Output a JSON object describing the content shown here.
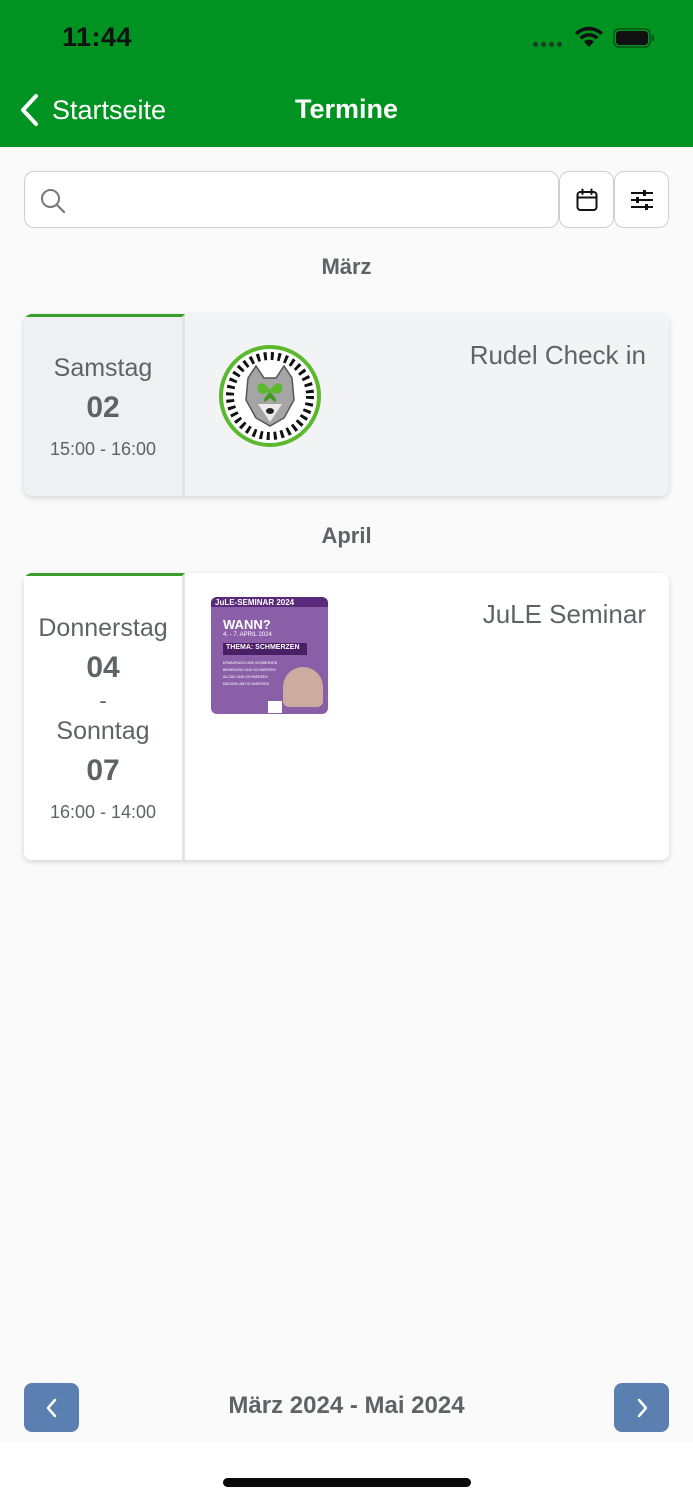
{
  "status": {
    "time": "11:44"
  },
  "nav": {
    "back_label": "Startseite",
    "title": "Termine"
  },
  "search": {
    "value": ""
  },
  "sections": [
    {
      "month": "März",
      "events": [
        {
          "day": "Samstag",
          "date": "02",
          "time": "15:00 - 16:00",
          "title": "Rudel Check in"
        }
      ]
    },
    {
      "month": "April",
      "events": [
        {
          "day_start": "Donnerstag",
          "date_start": "04",
          "dash": "-",
          "day_end": "Sonntag",
          "date_end": "07",
          "time": "16:00 - 14:00",
          "title": "JuLE Seminar",
          "poster": {
            "banner": "JuLE-SEMINAR 2024",
            "headline": "WANN?",
            "dates": "4. - 7. APRIL 2024",
            "theme": "THEMA: SCHMERZEN",
            "topics": [
              "ERNÄHRUNG UND SCHMERZEN",
              "BEWEGUNG UND SCHMERZEN",
              "ALLTAG UND SCHMERZEN",
              "MEDIZIN UND SCHMERZEN"
            ]
          }
        }
      ]
    }
  ],
  "pager": {
    "range": "März 2024 - Mai 2024"
  },
  "colors": {
    "header": "#019321",
    "accent_border": "#3a9c2a",
    "pager_button": "#5a7fb0",
    "text": "#5f6368"
  }
}
